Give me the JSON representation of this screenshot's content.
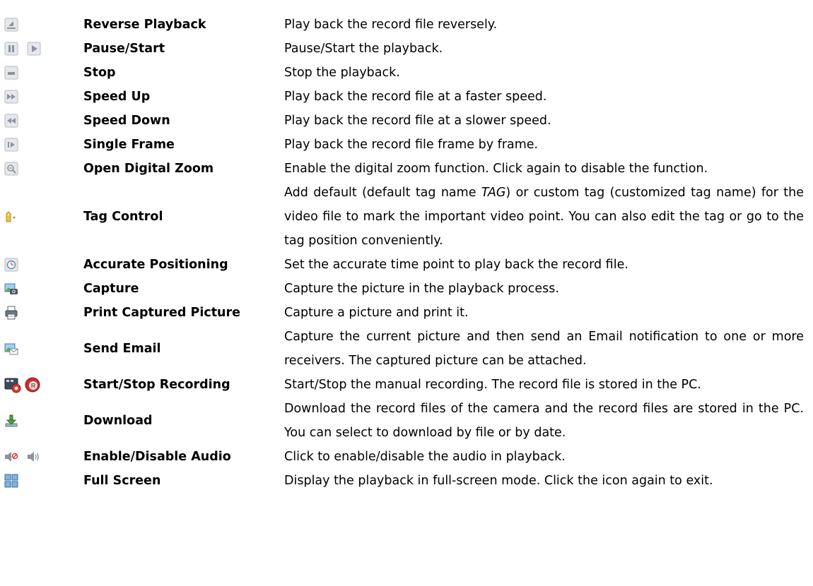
{
  "rows": [
    {
      "name": "Reverse Playback",
      "desc": "Play back the record file reversely."
    },
    {
      "name": "Pause/Start",
      "desc": "Pause/Start the playback."
    },
    {
      "name": "Stop",
      "desc": "Stop the playback."
    },
    {
      "name": "Speed Up",
      "desc": "Play back the record file at a faster speed."
    },
    {
      "name": "Speed Down",
      "desc": "Play back the record file at a slower speed."
    },
    {
      "name": "Single Frame",
      "desc": "Play back the record file frame by frame."
    },
    {
      "name": "Open Digital Zoom",
      "desc": "Enable the digital zoom function. Click again to disable the function."
    },
    {
      "name": "Tag Control",
      "desc_pre": "Add default (default tag name ",
      "desc_em": "TAG",
      "desc_post": ") or custom tag (customized tag name) for the video file to mark the important video point. You can also edit the tag or go to the tag position conveniently."
    },
    {
      "name": "Accurate Positioning",
      "desc": "Set the accurate time point to play back the record file."
    },
    {
      "name": "Capture",
      "desc": "Capture the picture in the playback process."
    },
    {
      "name": "Print Captured Picture",
      "desc": "Capture a picture and print it."
    },
    {
      "name": "Send Email",
      "desc": "Capture the current picture and then send an Email notification to one or more receivers. The captured picture can be attached."
    },
    {
      "name": "Start/Stop Recording",
      "desc": "Start/Stop the manual recording. The record file is stored in the PC."
    },
    {
      "name": "Download",
      "desc": "Download the record files of the camera and the record files are stored in the PC. You can select to download by file or by date."
    },
    {
      "name": "Enable/Disable Audio",
      "desc": "Click to enable/disable the audio in playback."
    },
    {
      "name": "Full Screen",
      "desc": "Display the playback in full-screen mode. Click the icon again to exit."
    }
  ],
  "icons": [
    [
      "reverse-playback-icon"
    ],
    [
      "pause-icon",
      "start-icon"
    ],
    [
      "stop-icon"
    ],
    [
      "speed-up-icon"
    ],
    [
      "speed-down-icon"
    ],
    [
      "single-frame-icon"
    ],
    [
      "digital-zoom-icon"
    ],
    [
      "tag-control-icon"
    ],
    [
      "accurate-positioning-icon"
    ],
    [
      "capture-icon"
    ],
    [
      "print-icon"
    ],
    [
      "send-email-icon"
    ],
    [
      "start-recording-icon",
      "stop-recording-icon"
    ],
    [
      "download-icon"
    ],
    [
      "audio-disabled-icon",
      "audio-enabled-icon"
    ],
    [
      "full-screen-icon"
    ]
  ]
}
